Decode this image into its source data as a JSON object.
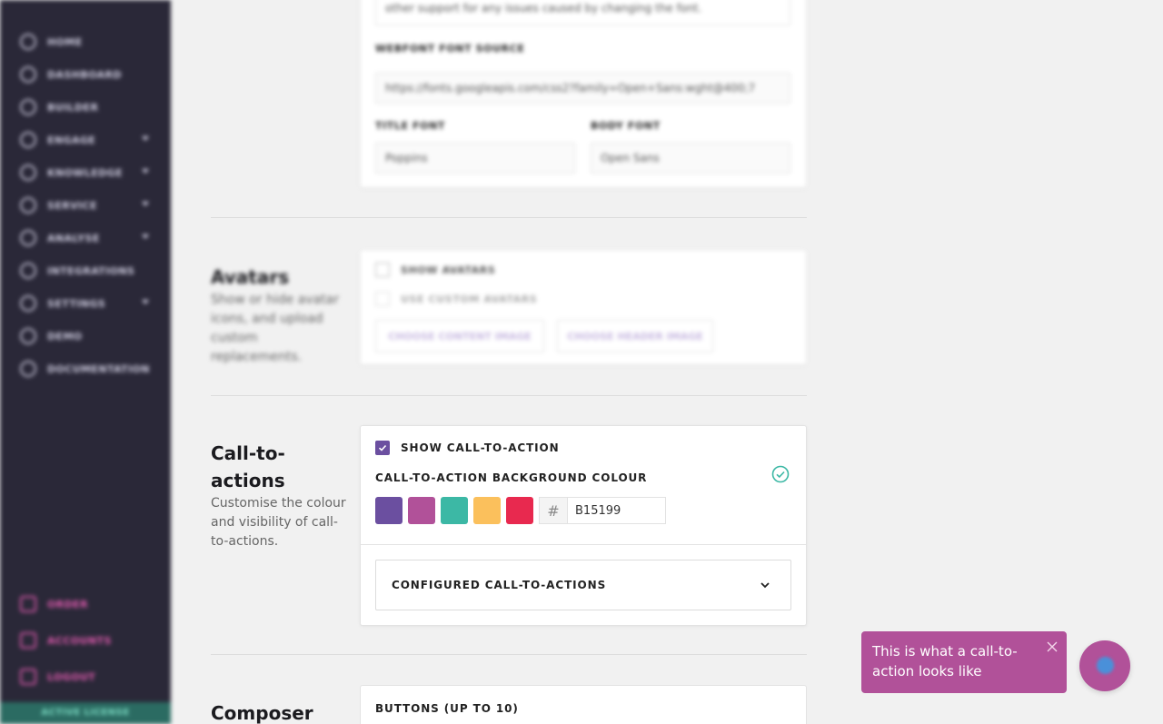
{
  "sidebar": {
    "items": [
      {
        "label": "HOME",
        "has_chevron": false
      },
      {
        "label": "DASHBOARD",
        "has_chevron": false
      },
      {
        "label": "BUILDER",
        "has_chevron": false
      },
      {
        "label": "ENGAGE",
        "has_chevron": true
      },
      {
        "label": "KNOWLEDGE",
        "has_chevron": true
      },
      {
        "label": "SERVICE",
        "has_chevron": true
      },
      {
        "label": "ANALYSE",
        "has_chevron": true
      },
      {
        "label": "INTEGRATIONS",
        "has_chevron": false
      },
      {
        "label": "SETTINGS",
        "has_chevron": true
      },
      {
        "label": "DEMO",
        "has_chevron": false
      },
      {
        "label": "DOCUMENTATION",
        "has_chevron": false
      }
    ],
    "bottom_items": [
      {
        "label": "ORDER"
      },
      {
        "label": "ACCOUNTS"
      },
      {
        "label": "LOGOUT"
      }
    ],
    "license_label": "ACTIVE LICENSE"
  },
  "fonts_section": {
    "note_text": "other support for any issues caused by changing the font.",
    "source_label": "WEBFONT FONT SOURCE",
    "source_value": "https://fonts.googleapis.com/css2?family=Open+Sans:wght@400;7",
    "title_font_label": "TITLE FONT",
    "title_font_value": "Poppins",
    "body_font_label": "BODY FONT",
    "body_font_value": "Open Sans"
  },
  "avatars_section": {
    "title": "Avatars",
    "description": "Show or hide avatar icons, and upload custom replacements.",
    "show_avatars_label": "SHOW AVATARS",
    "custom_avatars_label": "USE CUSTOM AVATARS",
    "choose_content_label": "CHOOSE CONTENT IMAGE",
    "choose_header_label": "CHOOSE HEADER IMAGE"
  },
  "cta_section": {
    "title_line1": "Call-to-",
    "title_line2": "actions",
    "description": "Customise the colour and visibility of call-to-actions.",
    "show_cta_label": "SHOW CALL-TO-ACTION",
    "show_cta_checked": true,
    "bg_colour_label": "CALL-TO-ACTION BACKGROUND COLOUR",
    "swatches": [
      "#6b4fa0",
      "#b15199",
      "#3cb8a5",
      "#fbc05c",
      "#e8294f"
    ],
    "hex_prefix": "#",
    "hex_value": "B15199",
    "configured_label": "CONFIGURED CALL-TO-ACTIONS"
  },
  "composer_section": {
    "title": "Composer",
    "buttons_label": "BUTTONS (UP TO 10)"
  },
  "preview": {
    "text": "This is what a call-to-action looks like",
    "accent": "#b15199"
  },
  "colors": {
    "sidebar_bg": "#2a2838",
    "primary_purple": "#6b4fa0",
    "success_teal": "#3cb8a5"
  }
}
